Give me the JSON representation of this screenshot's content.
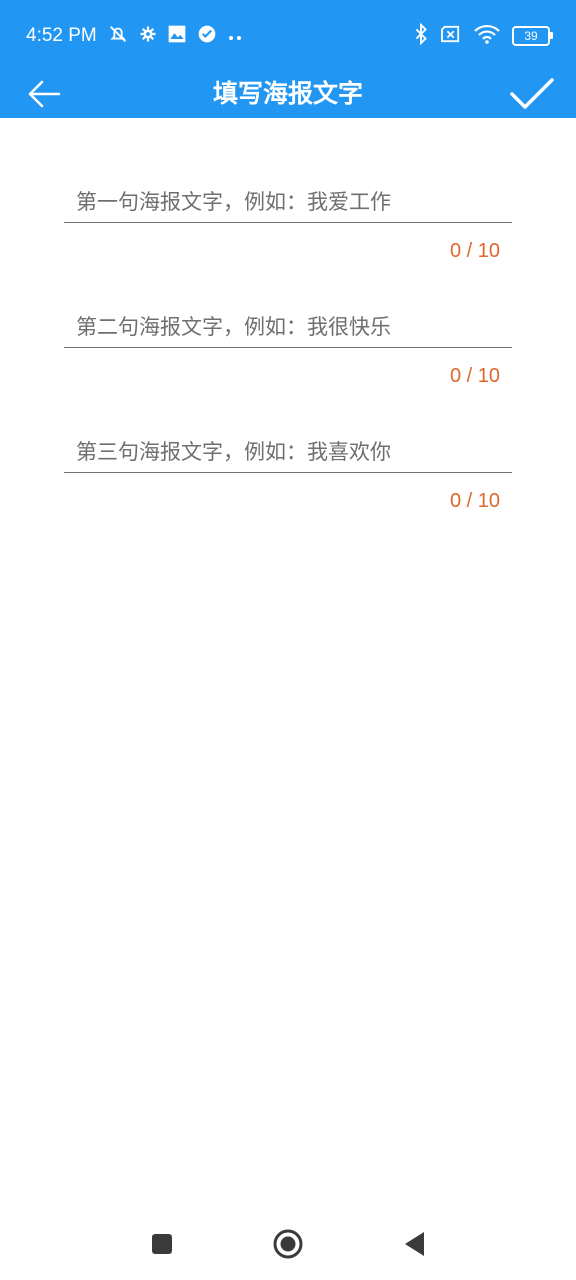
{
  "status_bar": {
    "time": "4:52 PM",
    "battery_level": "39",
    "icons": [
      "muted-bell-icon",
      "settings-icon",
      "photo-icon",
      "check-circle-icon",
      "more-dots-icon",
      "bluetooth-icon",
      "no-sim-icon",
      "wifi-icon",
      "battery-icon"
    ]
  },
  "app_bar": {
    "title": "填写海报文字",
    "back_icon": "arrow-left-icon",
    "confirm_icon": "check-icon",
    "background": "#2196F3"
  },
  "fields": [
    {
      "placeholder": "第一句海报文字，例如：我爱工作",
      "value": "",
      "counter": "0 / 10"
    },
    {
      "placeholder": "第二句海报文字，例如：我很快乐",
      "value": "",
      "counter": "0 / 10"
    },
    {
      "placeholder": "第三句海报文字，例如：我喜欢你",
      "value": "",
      "counter": "0 / 10"
    }
  ],
  "colors": {
    "counter": "#E0662C",
    "underline": "#707070"
  },
  "nav_bar": {
    "buttons": [
      "recents-square-icon",
      "home-circle-icon",
      "back-triangle-icon"
    ]
  }
}
